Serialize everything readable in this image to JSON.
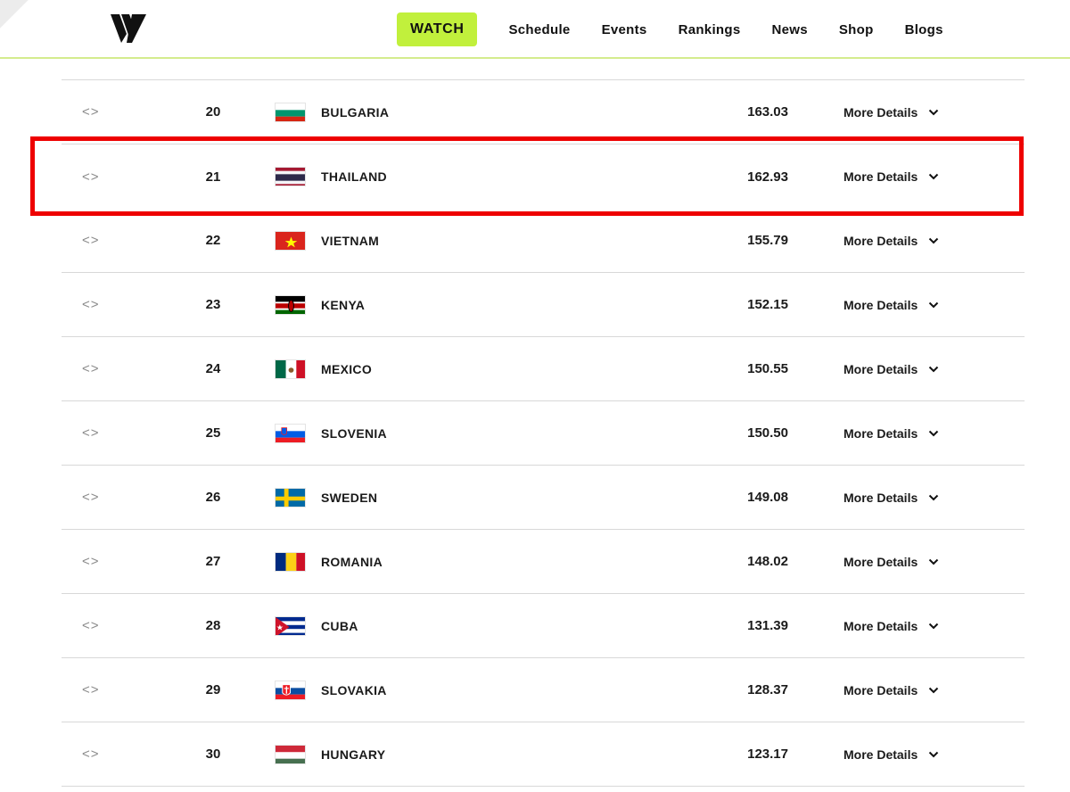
{
  "header": {
    "logo": "vnl-logo-icon",
    "nav": [
      {
        "label": "WATCH",
        "style": "primary"
      },
      {
        "label": "Schedule"
      },
      {
        "label": "Events"
      },
      {
        "label": "Rankings"
      },
      {
        "label": "News"
      },
      {
        "label": "Shop"
      },
      {
        "label": "Blogs"
      }
    ],
    "accent_color": "#c1f03c"
  },
  "rankings": {
    "details_label": "More Details",
    "move_indicator": "<>",
    "highlight_color": "#ee0000",
    "highlighted_rank": "21",
    "rows": [
      {
        "rank": "20",
        "country": "BULGARIA",
        "points": "163.03",
        "flag": "bulgaria-flag-icon"
      },
      {
        "rank": "21",
        "country": "THAILAND",
        "points": "162.93",
        "flag": "thailand-flag-icon"
      },
      {
        "rank": "22",
        "country": "VIETNAM",
        "points": "155.79",
        "flag": "vietnam-flag-icon"
      },
      {
        "rank": "23",
        "country": "KENYA",
        "points": "152.15",
        "flag": "kenya-flag-icon"
      },
      {
        "rank": "24",
        "country": "MEXICO",
        "points": "150.55",
        "flag": "mexico-flag-icon"
      },
      {
        "rank": "25",
        "country": "SLOVENIA",
        "points": "150.50",
        "flag": "slovenia-flag-icon"
      },
      {
        "rank": "26",
        "country": "SWEDEN",
        "points": "149.08",
        "flag": "sweden-flag-icon"
      },
      {
        "rank": "27",
        "country": "ROMANIA",
        "points": "148.02",
        "flag": "romania-flag-icon"
      },
      {
        "rank": "28",
        "country": "CUBA",
        "points": "131.39",
        "flag": "cuba-flag-icon"
      },
      {
        "rank": "29",
        "country": "SLOVAKIA",
        "points": "128.37",
        "flag": "slovakia-flag-icon"
      },
      {
        "rank": "30",
        "country": "HUNGARY",
        "points": "123.17",
        "flag": "hungary-flag-icon"
      }
    ]
  }
}
